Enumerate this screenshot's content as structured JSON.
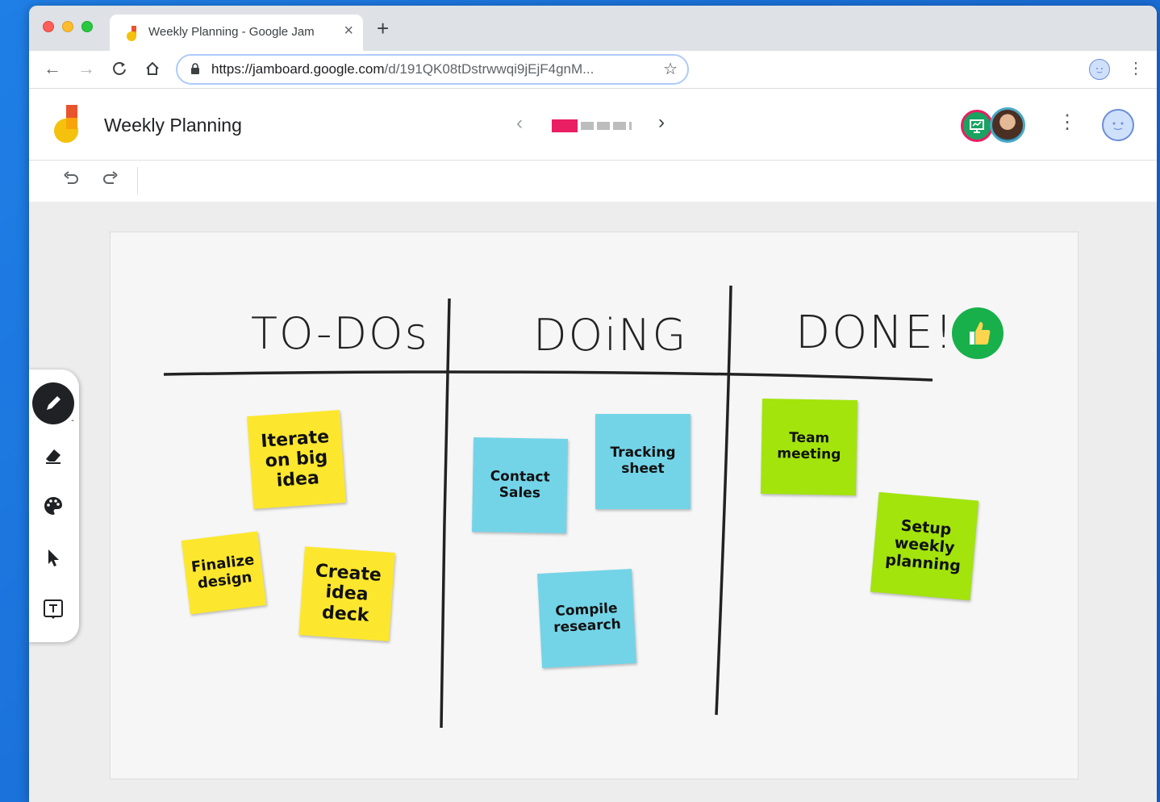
{
  "browser": {
    "tab_title": "Weekly Planning - Google Jam",
    "tab_close": "×",
    "new_tab": "+",
    "url_host": "https://jamboard.google.com",
    "url_path": "/d/191QK08tDstrwwqi9jEjF4gnM...",
    "back": "←",
    "forward": "→",
    "reload": "C",
    "home": "⌂",
    "star": "☆",
    "menu": "⋮"
  },
  "app": {
    "title": "Weekly Planning",
    "prev_frame": "‹",
    "next_frame": "›",
    "frames_total": 4,
    "active_frame": 1,
    "menu": "⋮",
    "colors": {
      "active_frame": "#e91e63",
      "yellow_note": "#fde72e",
      "blue_note": "#73d4e8",
      "green_note": "#a2e40c"
    }
  },
  "board": {
    "headers": {
      "todo": "TO-DOs",
      "doing": "DOiNG",
      "done": "DONE!"
    },
    "notes": {
      "iterate": [
        "Iterate",
        "on big",
        "idea"
      ],
      "finalize": [
        "Finalize",
        "design"
      ],
      "create_deck": [
        "Create",
        "idea",
        "deck"
      ],
      "contact_sales": [
        "Contact",
        "Sales"
      ],
      "tracking_sheet": [
        "Tracking",
        "sheet"
      ],
      "compile_research": [
        "Compile",
        "research"
      ],
      "team_meeting": [
        "Team",
        "meeting"
      ],
      "setup_planning": [
        "Setup",
        "weekly",
        "planning"
      ]
    },
    "sticker": "thumbs-up-icon"
  },
  "tools": [
    "pen-icon",
    "eraser-icon",
    "palette-icon",
    "select-arrow-icon",
    "text-box-icon"
  ]
}
